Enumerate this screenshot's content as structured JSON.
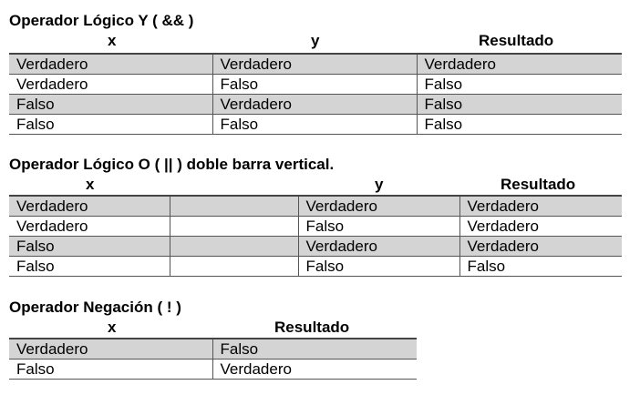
{
  "and_section": {
    "title": "Operador Lógico Y ( && )",
    "headers": {
      "x": "x",
      "y": "y",
      "result": "Resultado"
    },
    "rows": [
      [
        "Verdadero",
        "Verdadero",
        "Verdadero"
      ],
      [
        "Verdadero",
        "Falso",
        "Falso"
      ],
      [
        "Falso",
        "Verdadero",
        "Falso"
      ],
      [
        "Falso",
        "Falso",
        "Falso"
      ]
    ]
  },
  "or_section": {
    "title": "Operador Lógico O ( || ) doble barra vertical.",
    "headers": {
      "x": "x",
      "y": "y",
      "result": "Resultado"
    },
    "rows": [
      [
        "Verdadero",
        "",
        "Verdadero",
        "Verdadero"
      ],
      [
        "Verdadero",
        "",
        "Falso",
        "Verdadero"
      ],
      [
        "Falso",
        "",
        "Verdadero",
        "Verdadero"
      ],
      [
        "Falso",
        "",
        "Falso",
        "Falso"
      ]
    ]
  },
  "not_section": {
    "title": "Operador Negación ( ! )",
    "headers": {
      "x": "x",
      "result": "Resultado"
    },
    "rows": [
      [
        "Verdadero",
        "Falso"
      ],
      [
        "Falso",
        "Verdadero"
      ]
    ]
  }
}
